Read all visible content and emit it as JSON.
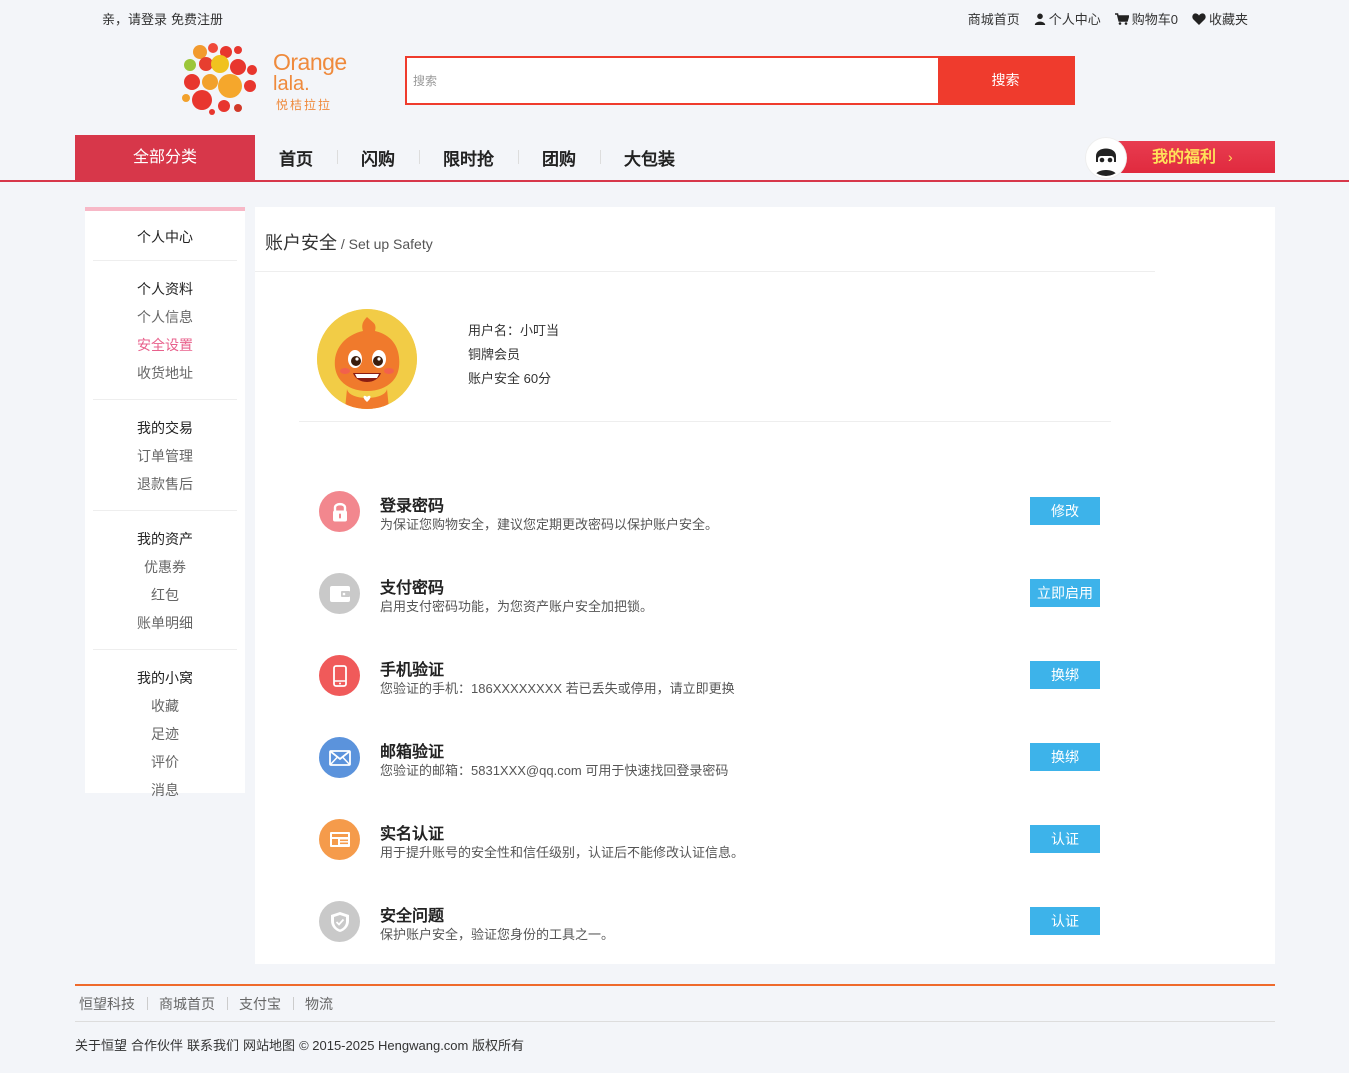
{
  "topbar": {
    "greeting": "亲，请登录",
    "register": "免费注册",
    "links": [
      {
        "label": "商城首页",
        "icon": "none"
      },
      {
        "label": "个人中心",
        "icon": "user-icon"
      },
      {
        "label": "购物车0",
        "icon": "cart-icon"
      },
      {
        "label": "收藏夹",
        "icon": "heart-icon"
      }
    ]
  },
  "logo": {
    "line1": "Orange",
    "line2": "lala.",
    "line3": "悦桔拉拉"
  },
  "search": {
    "placeholder": "搜索",
    "button": "搜索"
  },
  "nav": {
    "all_categories": "全部分类",
    "items": [
      "首页",
      "闪购",
      "限时抢",
      "团购",
      "大包装"
    ],
    "welfare": "我的福利",
    "welfare_arrow": "›"
  },
  "sidebar": {
    "title": "个人中心",
    "groups": [
      {
        "title": "个人资料",
        "items": [
          "个人信息",
          "安全设置",
          "收货地址"
        ],
        "active": "安全设置"
      },
      {
        "title": "我的交易",
        "items": [
          "订单管理",
          "退款售后"
        ]
      },
      {
        "title": "我的资产",
        "items": [
          "优惠券",
          "红包",
          "账单明细"
        ]
      },
      {
        "title": "我的小窝",
        "items": [
          "收藏",
          "足迹",
          "评价",
          "消息"
        ]
      }
    ]
  },
  "main": {
    "title": "账户安全",
    "subtitle": " / Set up Safety",
    "profile": {
      "username": "用户名：小叮当",
      "level": "铜牌会员",
      "score": "账户安全 60分"
    },
    "items": [
      {
        "title": "登录密码",
        "desc": "为保证您购物安全，建议您定期更改密码以保护账户安全。",
        "action": "修改",
        "icon": "lock-icon",
        "color": "#f2878e"
      },
      {
        "title": "支付密码",
        "desc": "启用支付密码功能，为您资产账户安全加把锁。",
        "action": "立即启用",
        "icon": "wallet-icon",
        "color": "#c9c9c9"
      },
      {
        "title": "手机验证",
        "desc": "您验证的手机：186XXXXXXXX 若已丢失或停用，请立即更换",
        "action": "换绑",
        "icon": "phone-icon",
        "color": "#f05a5a"
      },
      {
        "title": "邮箱验证",
        "desc": "您验证的邮箱：5831XXX@qq.com 可用于快速找回登录密码",
        "action": "换绑",
        "icon": "mail-icon",
        "color": "#5b93dc"
      },
      {
        "title": "实名认证",
        "desc": "用于提升账号的安全性和信任级别，认证后不能修改认证信息。",
        "action": "认证",
        "icon": "id-card-icon",
        "color": "#f59b4b"
      },
      {
        "title": "安全问题",
        "desc": "保护账户安全，验证您身份的工具之一。",
        "action": "认证",
        "icon": "shield-icon",
        "color": "#c9c9c9"
      }
    ]
  },
  "footer": {
    "links": [
      "恒望科技",
      "商城首页",
      "支付宝",
      "物流"
    ],
    "bottom_links": [
      "关于恒望",
      "合作伙伴",
      "联系我们",
      "网站地图"
    ],
    "copyright": "© 2015-2025 Hengwang.com 版权所有"
  }
}
